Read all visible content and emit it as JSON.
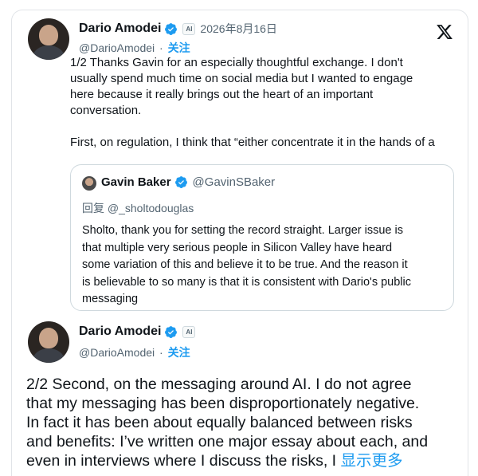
{
  "tweet1": {
    "author_name": "Dario Amodei",
    "handle": "@DarioAmodei",
    "separator": "·",
    "follow_label": "关注",
    "date": "2026年8月16日",
    "ai_badge": "AI",
    "lines": [
      "1/2 Thanks Gavin for an especially thoughtful exchange. I don't",
      "usually spend much time on social media but I wanted to engage",
      "here because it really brings out the heart of an important",
      "conversation.",
      "",
      "First, on regulation, I think that “either concentrate it in the hands of a"
    ]
  },
  "quote": {
    "author_name": "Gavin Baker",
    "handle": "@GavinSBaker",
    "reply_to": "回复 @_sholtodouglas",
    "lines": [
      "Sholto, thank you for setting the record straight. Larger issue is",
      "that multiple very serious people in Silicon Valley have heard",
      "some variation of this and believe it to be true. And the reason it",
      "is believable to so many is that it is consistent with Dario's public",
      "messaging"
    ]
  },
  "tweet2": {
    "author_name": "Dario Amodei",
    "handle": "@DarioAmodei",
    "separator": "·",
    "follow_label": "关注",
    "ai_badge": "AI",
    "lines": [
      "2/2 Second, on the messaging around AI.  I do not agree",
      "that my messaging has been disproportionately negative.",
      "In fact it has been about equally balanced between risks",
      "and benefits: I’ve written one major essay about each, and",
      "even in interviews where I discuss the risks, I "
    ],
    "show_more": "显示更多"
  },
  "icons": {
    "brand": "x-logo-icon",
    "verified": "verified-badge-icon"
  },
  "colors": {
    "accent": "#1d9bf0",
    "secondary_text": "#536471",
    "border": "#cfd9de"
  }
}
